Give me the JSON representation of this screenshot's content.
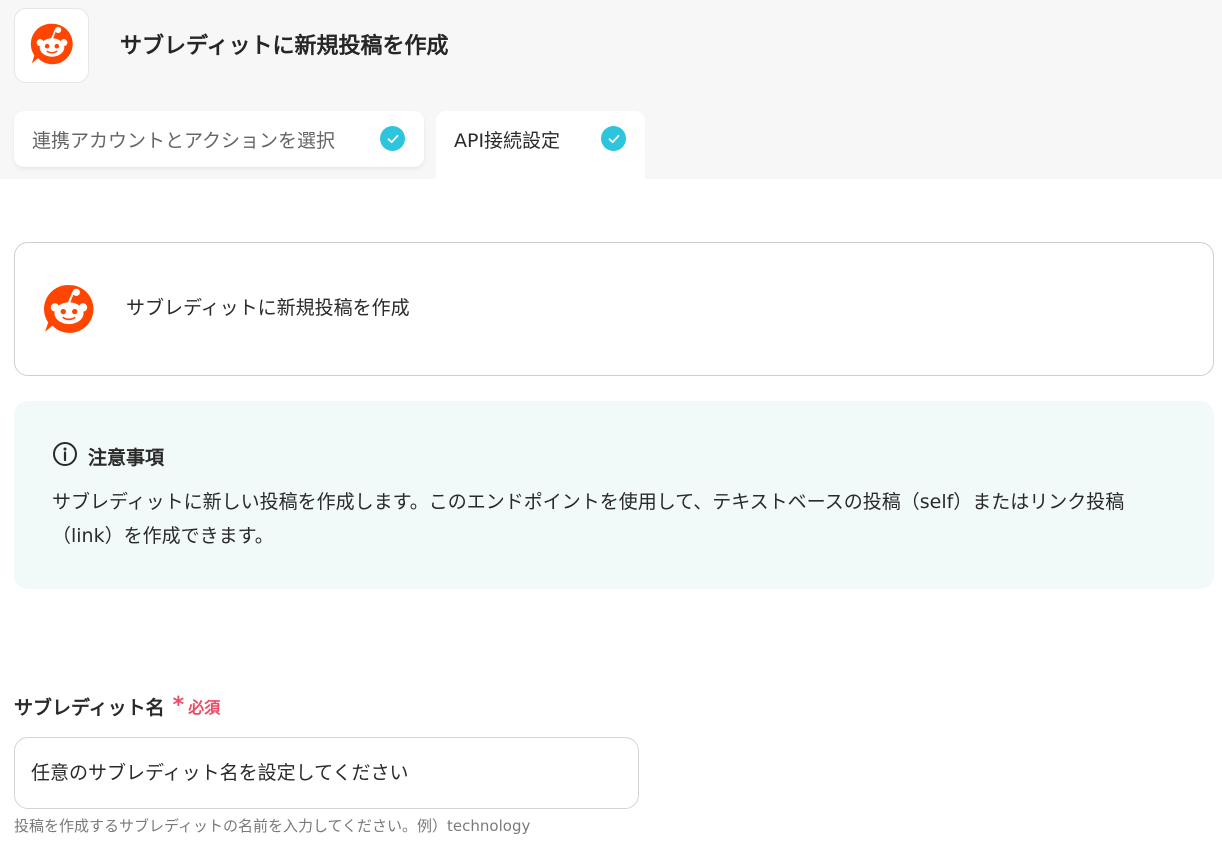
{
  "header": {
    "app_icon": "reddit-icon",
    "title": "サブレディットに新規投稿を作成"
  },
  "tabs": [
    {
      "label": "連携アカウントとアクションを選択",
      "completed": true,
      "active": false
    },
    {
      "label": "API接続設定",
      "completed": true,
      "active": true
    }
  ],
  "action": {
    "icon": "reddit-icon",
    "name": "サブレディットに新規投稿を作成"
  },
  "notice": {
    "icon": "info-icon",
    "title": "注意事項",
    "body": "サブレディットに新しい投稿を作成します。このエンドポイントを使用して、テキストベースの投稿（self）またはリンク投稿（link）を作成できます。"
  },
  "fields": [
    {
      "label": "サブレディット名",
      "required_label": "必須",
      "value": "",
      "placeholder": "任意のサブレディット名を設定してください",
      "help": "投稿を作成するサブレディットの名前を入力してください。例）technology"
    }
  ],
  "colors": {
    "reddit_orange": "#ff4500",
    "check_teal": "#2ec4dd",
    "required_red": "#ea4b66",
    "notice_bg": "#f1f9f9"
  }
}
